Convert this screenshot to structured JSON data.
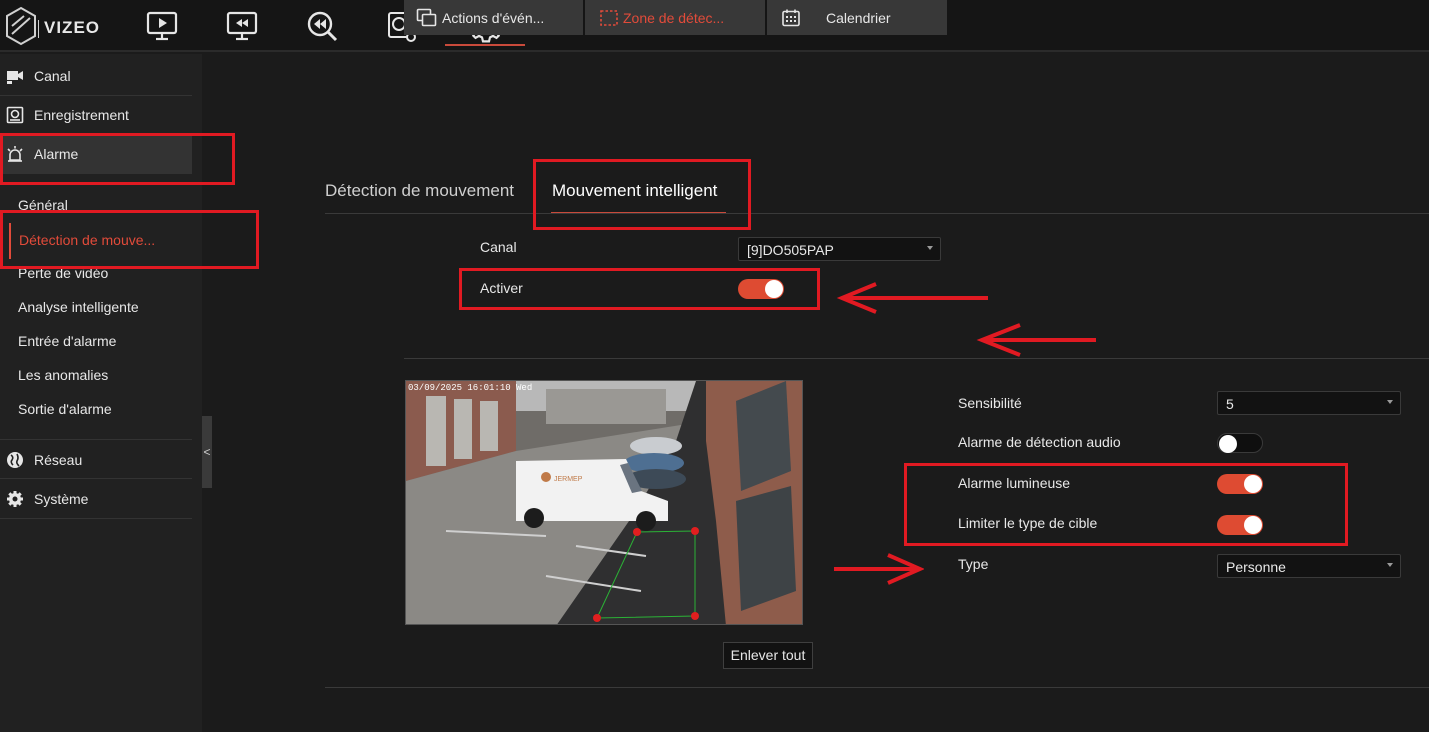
{
  "app": {
    "brand": "VIZEO"
  },
  "topnav": [
    {
      "name": "live-view-icon"
    },
    {
      "name": "playback-icon"
    },
    {
      "name": "search-playback-icon"
    },
    {
      "name": "thermal-icon"
    },
    {
      "name": "settings-gear-icon"
    }
  ],
  "sidebar": {
    "items": [
      {
        "label": "Canal",
        "icon": "camera-icon"
      },
      {
        "label": "Enregistrement",
        "icon": "recording-icon"
      },
      {
        "label": "Alarme",
        "icon": "alarm-icon"
      },
      {
        "label": "Réseau",
        "icon": "globe-icon"
      },
      {
        "label": "Système",
        "icon": "gear-icon"
      }
    ],
    "sub_items": [
      "Général",
      "Détection de mouve...",
      "Perte de vidéo",
      "Analyse intelligente",
      "Entrée d'alarme",
      "Les anomalies",
      "Sortie d'alarme"
    ],
    "collapse_label": "<"
  },
  "tabs": {
    "tab1": "Détection de mouvement",
    "tab2": "Mouvement intelligent"
  },
  "form": {
    "canal_label": "Canal",
    "canal_value": "[9]DO505PAP",
    "activer_label": "Activer",
    "activer_on": true
  },
  "subtabs": {
    "actions": "Actions d'évén...",
    "zone": "Zone de détec...",
    "calendar": "Calendrier"
  },
  "video": {
    "timestamp": "03/09/2025 16:01:10 Wed",
    "van_text": "JERMEP"
  },
  "settings": {
    "sensibilite_label": "Sensibilité",
    "sensibilite_value": "5",
    "audio_label": "Alarme de détection audio",
    "audio_on": false,
    "lumineuse_label": "Alarme lumineuse",
    "lumineuse_on": true,
    "limiter_label": "Limiter le type de cible",
    "limiter_on": true,
    "type_label": "Type",
    "type_value": "Personne"
  },
  "buttons": {
    "clear_all": "Enlever tout"
  },
  "colors": {
    "accent": "#de4b32",
    "annotation_red": "#e11a22",
    "active_text": "#e24b3a"
  }
}
